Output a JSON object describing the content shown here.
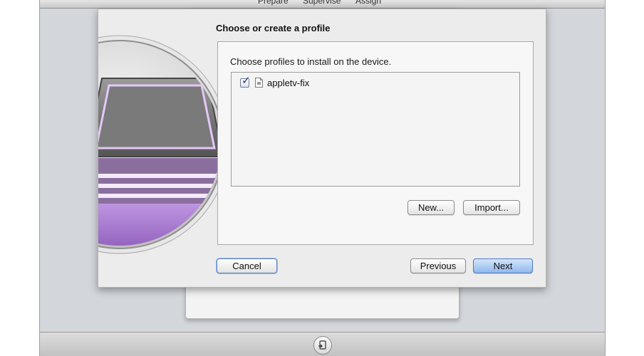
{
  "toolbar": {
    "tabs": [
      "Prepare",
      "Supervise",
      "Assign"
    ]
  },
  "sheet": {
    "title": "Choose or create a profile",
    "instructions": "Choose profiles to install on the device.",
    "profiles": [
      {
        "name": "appletv-fix",
        "checked": true
      }
    ],
    "new_label": "New...",
    "import_label": "Import...",
    "cancel_label": "Cancel",
    "previous_label": "Previous",
    "next_label": "Next"
  },
  "colors": {
    "accent": "#8fb8ec",
    "device_purple": "#b98ae0"
  },
  "icons": {
    "device": "ipad-device-icon",
    "profile": "document-icon",
    "bottom": "add-device-icon"
  }
}
